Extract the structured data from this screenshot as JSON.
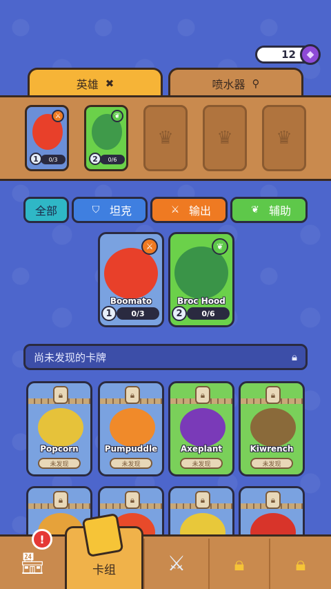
{
  "currency": {
    "amount": "12",
    "icon": "gem-icon"
  },
  "tabs": [
    {
      "label": "英雄",
      "icon": "crossed-swords-icon",
      "active": true
    },
    {
      "label": "喷水器",
      "icon": "sprinkler-icon",
      "active": false
    }
  ],
  "team": [
    {
      "level": "1",
      "progress": "0/3",
      "type": "red"
    },
    {
      "level": "2",
      "progress": "0/6",
      "type": "green"
    }
  ],
  "filters": [
    {
      "label": "全部"
    },
    {
      "label": "坦克",
      "icon": "shield-icon"
    },
    {
      "label": "输出",
      "icon": "sword-icon"
    },
    {
      "label": "辅助",
      "icon": "leaf-icon"
    }
  ],
  "deck": [
    {
      "name": "Boomato",
      "level": "1",
      "progress": "0/3"
    },
    {
      "name": "Broc Hood",
      "level": "2",
      "progress": "0/6"
    }
  ],
  "locked_section": {
    "title": "尚未发现的卡牌"
  },
  "locked_cards": [
    {
      "name": "Popcorn",
      "status": "未发现"
    },
    {
      "name": "Pumpuddle",
      "status": "未发现"
    },
    {
      "name": "Axeplant",
      "status": "未发现"
    },
    {
      "name": "Kiwrench",
      "status": "未发现"
    }
  ],
  "nav": {
    "deck_label": "卡组",
    "alert": "!"
  },
  "colors": {
    "tank": "#3f7fe0",
    "dps": "#ef7a22",
    "support": "#5ec84a",
    "all": "#2fb7c6"
  }
}
